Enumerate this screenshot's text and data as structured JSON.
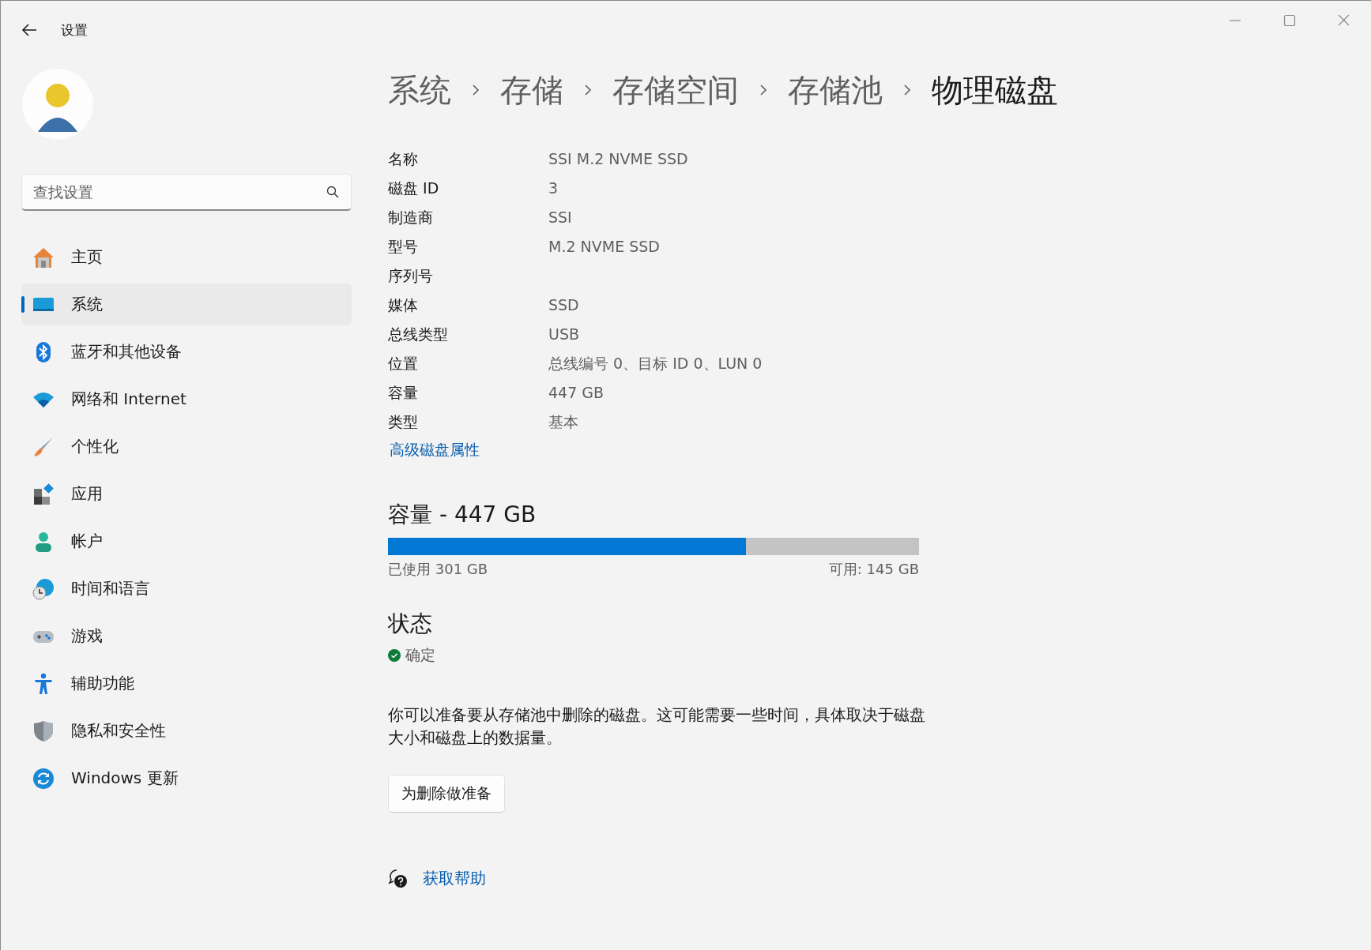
{
  "window": {
    "title": "设置"
  },
  "search": {
    "placeholder": "查找设置"
  },
  "nav": [
    {
      "label": "主页",
      "selected": false
    },
    {
      "label": "系统",
      "selected": true
    },
    {
      "label": "蓝牙和其他设备",
      "selected": false
    },
    {
      "label": "网络和 Internet",
      "selected": false
    },
    {
      "label": "个性化",
      "selected": false
    },
    {
      "label": "应用",
      "selected": false
    },
    {
      "label": "帐户",
      "selected": false
    },
    {
      "label": "时间和语言",
      "selected": false
    },
    {
      "label": "游戏",
      "selected": false
    },
    {
      "label": "辅助功能",
      "selected": false
    },
    {
      "label": "隐私和安全性",
      "selected": false
    },
    {
      "label": "Windows 更新",
      "selected": false
    }
  ],
  "breadcrumb": [
    "系统",
    "存储",
    "存储空间",
    "存储池",
    "物理磁盘"
  ],
  "properties": [
    {
      "label": "名称",
      "value": "SSI M.2 NVME SSD"
    },
    {
      "label": "磁盘 ID",
      "value": "3"
    },
    {
      "label": "制造商",
      "value": "SSI"
    },
    {
      "label": "型号",
      "value": "M.2 NVME SSD"
    },
    {
      "label": "序列号"
    },
    {
      "label": "媒体",
      "value": "SSD"
    },
    {
      "label": "总线类型",
      "value": "USB"
    },
    {
      "label": "位置",
      "value": "总线编号 0、目标 ID 0、LUN 0"
    },
    {
      "label": "容量",
      "value": "447 GB"
    },
    {
      "label": "类型",
      "value": "基本"
    }
  ],
  "advanced_link": "高级磁盘属性",
  "capacity": {
    "heading": "容量 - 447 GB",
    "level": 0.674,
    "used": "已使用 301 GB",
    "free": "可用: 145 GB"
  },
  "status": {
    "heading": "状态",
    "text": "确定"
  },
  "description": "你可以准备要从存储池中删除的磁盘。这可能需要一些时间，具体取决于磁盘大小和磁盘上的数据量。",
  "prepare_button": "为删除做准备",
  "help_link": "获取帮助"
}
